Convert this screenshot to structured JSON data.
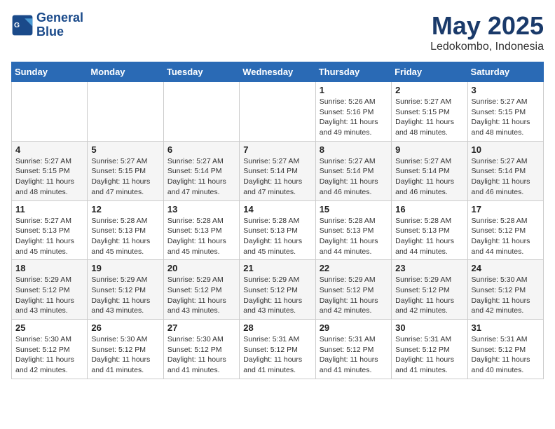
{
  "header": {
    "logo_line1": "General",
    "logo_line2": "Blue",
    "month": "May 2025",
    "location": "Ledokombo, Indonesia"
  },
  "weekdays": [
    "Sunday",
    "Monday",
    "Tuesday",
    "Wednesday",
    "Thursday",
    "Friday",
    "Saturday"
  ],
  "weeks": [
    [
      {
        "day": "",
        "info": ""
      },
      {
        "day": "",
        "info": ""
      },
      {
        "day": "",
        "info": ""
      },
      {
        "day": "",
        "info": ""
      },
      {
        "day": "1",
        "info": "Sunrise: 5:26 AM\nSunset: 5:16 PM\nDaylight: 11 hours\nand 49 minutes."
      },
      {
        "day": "2",
        "info": "Sunrise: 5:27 AM\nSunset: 5:15 PM\nDaylight: 11 hours\nand 48 minutes."
      },
      {
        "day": "3",
        "info": "Sunrise: 5:27 AM\nSunset: 5:15 PM\nDaylight: 11 hours\nand 48 minutes."
      }
    ],
    [
      {
        "day": "4",
        "info": "Sunrise: 5:27 AM\nSunset: 5:15 PM\nDaylight: 11 hours\nand 48 minutes."
      },
      {
        "day": "5",
        "info": "Sunrise: 5:27 AM\nSunset: 5:15 PM\nDaylight: 11 hours\nand 47 minutes."
      },
      {
        "day": "6",
        "info": "Sunrise: 5:27 AM\nSunset: 5:14 PM\nDaylight: 11 hours\nand 47 minutes."
      },
      {
        "day": "7",
        "info": "Sunrise: 5:27 AM\nSunset: 5:14 PM\nDaylight: 11 hours\nand 47 minutes."
      },
      {
        "day": "8",
        "info": "Sunrise: 5:27 AM\nSunset: 5:14 PM\nDaylight: 11 hours\nand 46 minutes."
      },
      {
        "day": "9",
        "info": "Sunrise: 5:27 AM\nSunset: 5:14 PM\nDaylight: 11 hours\nand 46 minutes."
      },
      {
        "day": "10",
        "info": "Sunrise: 5:27 AM\nSunset: 5:14 PM\nDaylight: 11 hours\nand 46 minutes."
      }
    ],
    [
      {
        "day": "11",
        "info": "Sunrise: 5:27 AM\nSunset: 5:13 PM\nDaylight: 11 hours\nand 45 minutes."
      },
      {
        "day": "12",
        "info": "Sunrise: 5:28 AM\nSunset: 5:13 PM\nDaylight: 11 hours\nand 45 minutes."
      },
      {
        "day": "13",
        "info": "Sunrise: 5:28 AM\nSunset: 5:13 PM\nDaylight: 11 hours\nand 45 minutes."
      },
      {
        "day": "14",
        "info": "Sunrise: 5:28 AM\nSunset: 5:13 PM\nDaylight: 11 hours\nand 45 minutes."
      },
      {
        "day": "15",
        "info": "Sunrise: 5:28 AM\nSunset: 5:13 PM\nDaylight: 11 hours\nand 44 minutes."
      },
      {
        "day": "16",
        "info": "Sunrise: 5:28 AM\nSunset: 5:13 PM\nDaylight: 11 hours\nand 44 minutes."
      },
      {
        "day": "17",
        "info": "Sunrise: 5:28 AM\nSunset: 5:12 PM\nDaylight: 11 hours\nand 44 minutes."
      }
    ],
    [
      {
        "day": "18",
        "info": "Sunrise: 5:29 AM\nSunset: 5:12 PM\nDaylight: 11 hours\nand 43 minutes."
      },
      {
        "day": "19",
        "info": "Sunrise: 5:29 AM\nSunset: 5:12 PM\nDaylight: 11 hours\nand 43 minutes."
      },
      {
        "day": "20",
        "info": "Sunrise: 5:29 AM\nSunset: 5:12 PM\nDaylight: 11 hours\nand 43 minutes."
      },
      {
        "day": "21",
        "info": "Sunrise: 5:29 AM\nSunset: 5:12 PM\nDaylight: 11 hours\nand 43 minutes."
      },
      {
        "day": "22",
        "info": "Sunrise: 5:29 AM\nSunset: 5:12 PM\nDaylight: 11 hours\nand 42 minutes."
      },
      {
        "day": "23",
        "info": "Sunrise: 5:29 AM\nSunset: 5:12 PM\nDaylight: 11 hours\nand 42 minutes."
      },
      {
        "day": "24",
        "info": "Sunrise: 5:30 AM\nSunset: 5:12 PM\nDaylight: 11 hours\nand 42 minutes."
      }
    ],
    [
      {
        "day": "25",
        "info": "Sunrise: 5:30 AM\nSunset: 5:12 PM\nDaylight: 11 hours\nand 42 minutes."
      },
      {
        "day": "26",
        "info": "Sunrise: 5:30 AM\nSunset: 5:12 PM\nDaylight: 11 hours\nand 41 minutes."
      },
      {
        "day": "27",
        "info": "Sunrise: 5:30 AM\nSunset: 5:12 PM\nDaylight: 11 hours\nand 41 minutes."
      },
      {
        "day": "28",
        "info": "Sunrise: 5:31 AM\nSunset: 5:12 PM\nDaylight: 11 hours\nand 41 minutes."
      },
      {
        "day": "29",
        "info": "Sunrise: 5:31 AM\nSunset: 5:12 PM\nDaylight: 11 hours\nand 41 minutes."
      },
      {
        "day": "30",
        "info": "Sunrise: 5:31 AM\nSunset: 5:12 PM\nDaylight: 11 hours\nand 41 minutes."
      },
      {
        "day": "31",
        "info": "Sunrise: 5:31 AM\nSunset: 5:12 PM\nDaylight: 11 hours\nand 40 minutes."
      }
    ]
  ]
}
